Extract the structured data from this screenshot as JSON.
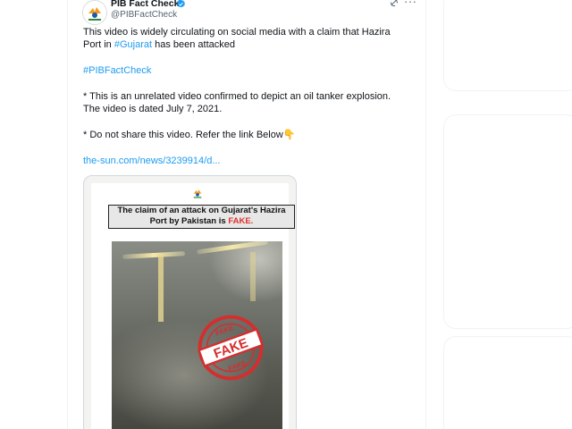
{
  "tweet": {
    "author_name": "PIB Fact Check",
    "author_handle": "@PIBFactCheck",
    "line1": "This video is widely circulating on social media with a claim that Hazira",
    "line2_prefix": "Port in ",
    "line2_hashtag": "#Gujarat",
    "line2_suffix": " has been attacked",
    "hashtag": "#PIBFactCheck",
    "note1_line1": "* This is an unrelated video confirmed to depict an oil tanker explosion.",
    "note1_line2": "The video is dated July 7, 2021.",
    "note2": "* Do not share this video. Refer the link Below",
    "note2_emoji": "👇",
    "link_text": "the-sun.com/news/3239914/d..."
  },
  "media": {
    "claim_line1": "The claim of an attack on Gujarat's Hazira",
    "claim_line2_prefix": "Port by Pakistan is ",
    "claim_line2_fake": "FAKE.",
    "stamp_word": "FAKE"
  },
  "icons": {
    "verified": "verified-badge-icon",
    "grok": "grok-icon",
    "more": "more-options-icon",
    "logo": "pib-logo-icon"
  },
  "colors": {
    "link": "#1d9bf0",
    "verified": "#1d9bf0",
    "fake_red": "#e0332c"
  }
}
